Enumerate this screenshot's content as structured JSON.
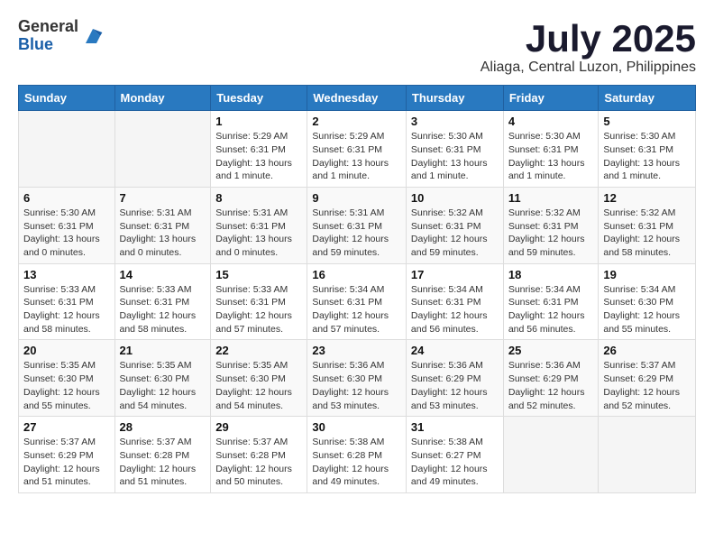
{
  "logo": {
    "general": "General",
    "blue": "Blue"
  },
  "title": "July 2025",
  "location": "Aliaga, Central Luzon, Philippines",
  "days_of_week": [
    "Sunday",
    "Monday",
    "Tuesday",
    "Wednesday",
    "Thursday",
    "Friday",
    "Saturday"
  ],
  "weeks": [
    [
      {
        "day": "",
        "info": ""
      },
      {
        "day": "",
        "info": ""
      },
      {
        "day": "1",
        "info": "Sunrise: 5:29 AM\nSunset: 6:31 PM\nDaylight: 13 hours and 1 minute."
      },
      {
        "day": "2",
        "info": "Sunrise: 5:29 AM\nSunset: 6:31 PM\nDaylight: 13 hours and 1 minute."
      },
      {
        "day": "3",
        "info": "Sunrise: 5:30 AM\nSunset: 6:31 PM\nDaylight: 13 hours and 1 minute."
      },
      {
        "day": "4",
        "info": "Sunrise: 5:30 AM\nSunset: 6:31 PM\nDaylight: 13 hours and 1 minute."
      },
      {
        "day": "5",
        "info": "Sunrise: 5:30 AM\nSunset: 6:31 PM\nDaylight: 13 hours and 1 minute."
      }
    ],
    [
      {
        "day": "6",
        "info": "Sunrise: 5:30 AM\nSunset: 6:31 PM\nDaylight: 13 hours and 0 minutes."
      },
      {
        "day": "7",
        "info": "Sunrise: 5:31 AM\nSunset: 6:31 PM\nDaylight: 13 hours and 0 minutes."
      },
      {
        "day": "8",
        "info": "Sunrise: 5:31 AM\nSunset: 6:31 PM\nDaylight: 13 hours and 0 minutes."
      },
      {
        "day": "9",
        "info": "Sunrise: 5:31 AM\nSunset: 6:31 PM\nDaylight: 12 hours and 59 minutes."
      },
      {
        "day": "10",
        "info": "Sunrise: 5:32 AM\nSunset: 6:31 PM\nDaylight: 12 hours and 59 minutes."
      },
      {
        "day": "11",
        "info": "Sunrise: 5:32 AM\nSunset: 6:31 PM\nDaylight: 12 hours and 59 minutes."
      },
      {
        "day": "12",
        "info": "Sunrise: 5:32 AM\nSunset: 6:31 PM\nDaylight: 12 hours and 58 minutes."
      }
    ],
    [
      {
        "day": "13",
        "info": "Sunrise: 5:33 AM\nSunset: 6:31 PM\nDaylight: 12 hours and 58 minutes."
      },
      {
        "day": "14",
        "info": "Sunrise: 5:33 AM\nSunset: 6:31 PM\nDaylight: 12 hours and 58 minutes."
      },
      {
        "day": "15",
        "info": "Sunrise: 5:33 AM\nSunset: 6:31 PM\nDaylight: 12 hours and 57 minutes."
      },
      {
        "day": "16",
        "info": "Sunrise: 5:34 AM\nSunset: 6:31 PM\nDaylight: 12 hours and 57 minutes."
      },
      {
        "day": "17",
        "info": "Sunrise: 5:34 AM\nSunset: 6:31 PM\nDaylight: 12 hours and 56 minutes."
      },
      {
        "day": "18",
        "info": "Sunrise: 5:34 AM\nSunset: 6:31 PM\nDaylight: 12 hours and 56 minutes."
      },
      {
        "day": "19",
        "info": "Sunrise: 5:34 AM\nSunset: 6:30 PM\nDaylight: 12 hours and 55 minutes."
      }
    ],
    [
      {
        "day": "20",
        "info": "Sunrise: 5:35 AM\nSunset: 6:30 PM\nDaylight: 12 hours and 55 minutes."
      },
      {
        "day": "21",
        "info": "Sunrise: 5:35 AM\nSunset: 6:30 PM\nDaylight: 12 hours and 54 minutes."
      },
      {
        "day": "22",
        "info": "Sunrise: 5:35 AM\nSunset: 6:30 PM\nDaylight: 12 hours and 54 minutes."
      },
      {
        "day": "23",
        "info": "Sunrise: 5:36 AM\nSunset: 6:30 PM\nDaylight: 12 hours and 53 minutes."
      },
      {
        "day": "24",
        "info": "Sunrise: 5:36 AM\nSunset: 6:29 PM\nDaylight: 12 hours and 53 minutes."
      },
      {
        "day": "25",
        "info": "Sunrise: 5:36 AM\nSunset: 6:29 PM\nDaylight: 12 hours and 52 minutes."
      },
      {
        "day": "26",
        "info": "Sunrise: 5:37 AM\nSunset: 6:29 PM\nDaylight: 12 hours and 52 minutes."
      }
    ],
    [
      {
        "day": "27",
        "info": "Sunrise: 5:37 AM\nSunset: 6:29 PM\nDaylight: 12 hours and 51 minutes."
      },
      {
        "day": "28",
        "info": "Sunrise: 5:37 AM\nSunset: 6:28 PM\nDaylight: 12 hours and 51 minutes."
      },
      {
        "day": "29",
        "info": "Sunrise: 5:37 AM\nSunset: 6:28 PM\nDaylight: 12 hours and 50 minutes."
      },
      {
        "day": "30",
        "info": "Sunrise: 5:38 AM\nSunset: 6:28 PM\nDaylight: 12 hours and 49 minutes."
      },
      {
        "day": "31",
        "info": "Sunrise: 5:38 AM\nSunset: 6:27 PM\nDaylight: 12 hours and 49 minutes."
      },
      {
        "day": "",
        "info": ""
      },
      {
        "day": "",
        "info": ""
      }
    ]
  ]
}
